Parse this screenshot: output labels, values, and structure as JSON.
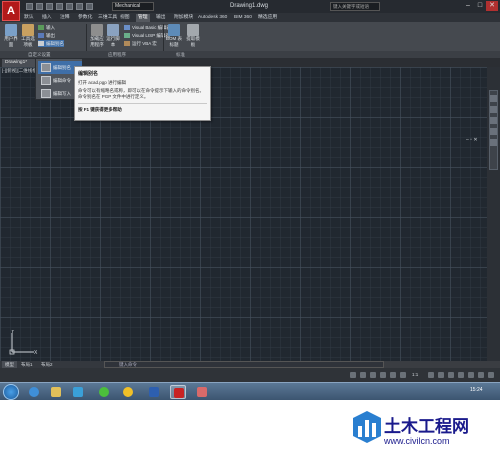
{
  "colors": {
    "accent": "#b21a1a",
    "canvas_bg": "#212830",
    "highlight": "#3f6fa8",
    "watermark": "#1a1a8c"
  },
  "titlebar": {
    "logo_text": "A",
    "workspace": "Mechanical",
    "doc_title": "Drawing1.dwg",
    "search_placeholder": "键入关键字或短语",
    "min": "–",
    "max": "□",
    "close": "✕"
  },
  "tabs": [
    "默认",
    "插入",
    "注释",
    "参数化",
    "三维工具",
    "视图",
    "管理",
    "输出",
    "附加模块",
    "Autodesk 360",
    "BIM 360",
    "精选应用"
  ],
  "active_tab": "管理",
  "ribbon": {
    "user_interface": "用户界面",
    "tool_palettes": "工具选项板",
    "input": "输入",
    "output": "输出",
    "edit_alias": "编辑别名",
    "load_app": "加载应用程序",
    "run_script": "运行脚本",
    "vb_editor": "Visual Basic 编辑器",
    "vlisp_editor": "Visual LISP 编辑器",
    "run_vba": "运行 VBA 宏",
    "bom_tool": "BOM 表标题",
    "extract": "提取模板",
    "panel_custom": "自定义设置",
    "panel_apps": "应用程序",
    "panel_standards": "标准"
  },
  "file_tab": "Drawing1*",
  "view_control": "[-][俯视][二维线框]",
  "viewcube": "– ▫ ✕",
  "dropdown": {
    "items": [
      "编辑别名",
      "编辑命令",
      "编辑写入"
    ]
  },
  "tooltip": {
    "title": "编辑别名",
    "command": "打开 acad.pgp 进行编辑",
    "body": "命令可以有缩略名或称，即可以在命令提示下输入的命令别名。命令别名在 PGP 文件中进行定义。",
    "help": "按 F1 键获得更多帮助"
  },
  "cmdline": {
    "placeholder": "键入命令"
  },
  "layout_tabs": [
    "模型",
    "布局1",
    "布局2"
  ],
  "status": {
    "coords": "",
    "scale": "1:1"
  },
  "taskbar": {
    "time": "15:24"
  },
  "watermark": {
    "title": "土木工程网",
    "url": "www.civilcn.com"
  }
}
